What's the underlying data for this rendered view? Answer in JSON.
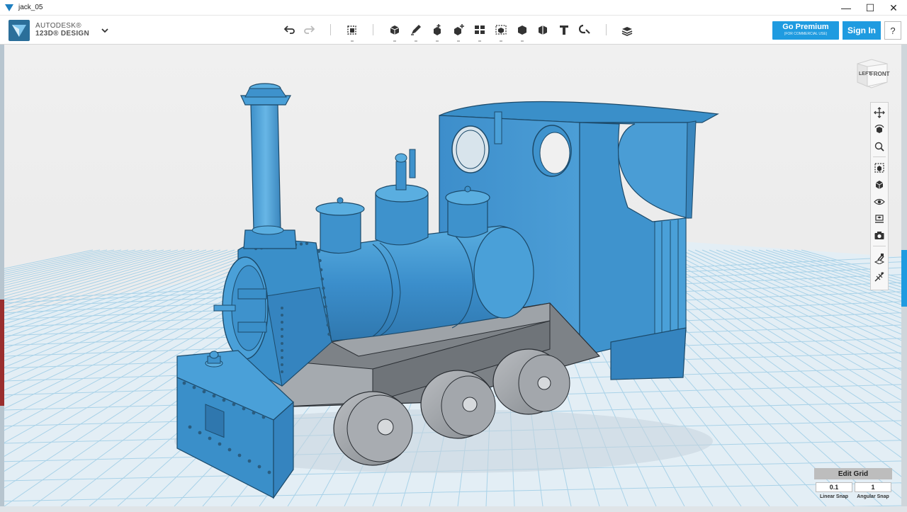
{
  "window": {
    "title": "jack_05",
    "minimize_glyph": "—",
    "maximize_glyph": "☐",
    "close_glyph": "✕"
  },
  "brand": {
    "line1": "AUTODESK®",
    "line2": "123D® DESIGN"
  },
  "toolbar": {
    "tools": [
      "undo-icon",
      "redo-icon",
      "transform-icon",
      "primitives-icon",
      "sketch-icon",
      "construct-icon",
      "modify-icon",
      "pattern-icon",
      "group-icon",
      "combine-icon",
      "measure-icon",
      "text-icon",
      "snap-icon",
      "material-icon"
    ]
  },
  "account": {
    "premium_label": "Go Premium",
    "premium_sub": "(FOR COMMERCIAL USE)",
    "signin_label": "Sign In",
    "help_label": "?"
  },
  "viewcube": {
    "left_label": "LEFT",
    "front_label": "FRONT"
  },
  "navbar": {
    "tools": [
      "pan-icon",
      "orbit-icon",
      "zoom-icon",
      "fit-icon",
      "view-icon",
      "visibility-icon",
      "materials-icon",
      "screenshot-icon",
      "grid-icon",
      "snap-tools-icon"
    ]
  },
  "grid": {
    "title": "Edit Grid",
    "linear_snap_value": "0.1",
    "angular_snap_value": "1",
    "linear_snap_label": "Linear Snap",
    "angular_snap_label": "Angular Snap"
  },
  "colors": {
    "accent": "#1f9be0",
    "model_blue": "#3a8fc9",
    "model_grey": "#8f9499",
    "grid_line": "#9ecbe3"
  }
}
